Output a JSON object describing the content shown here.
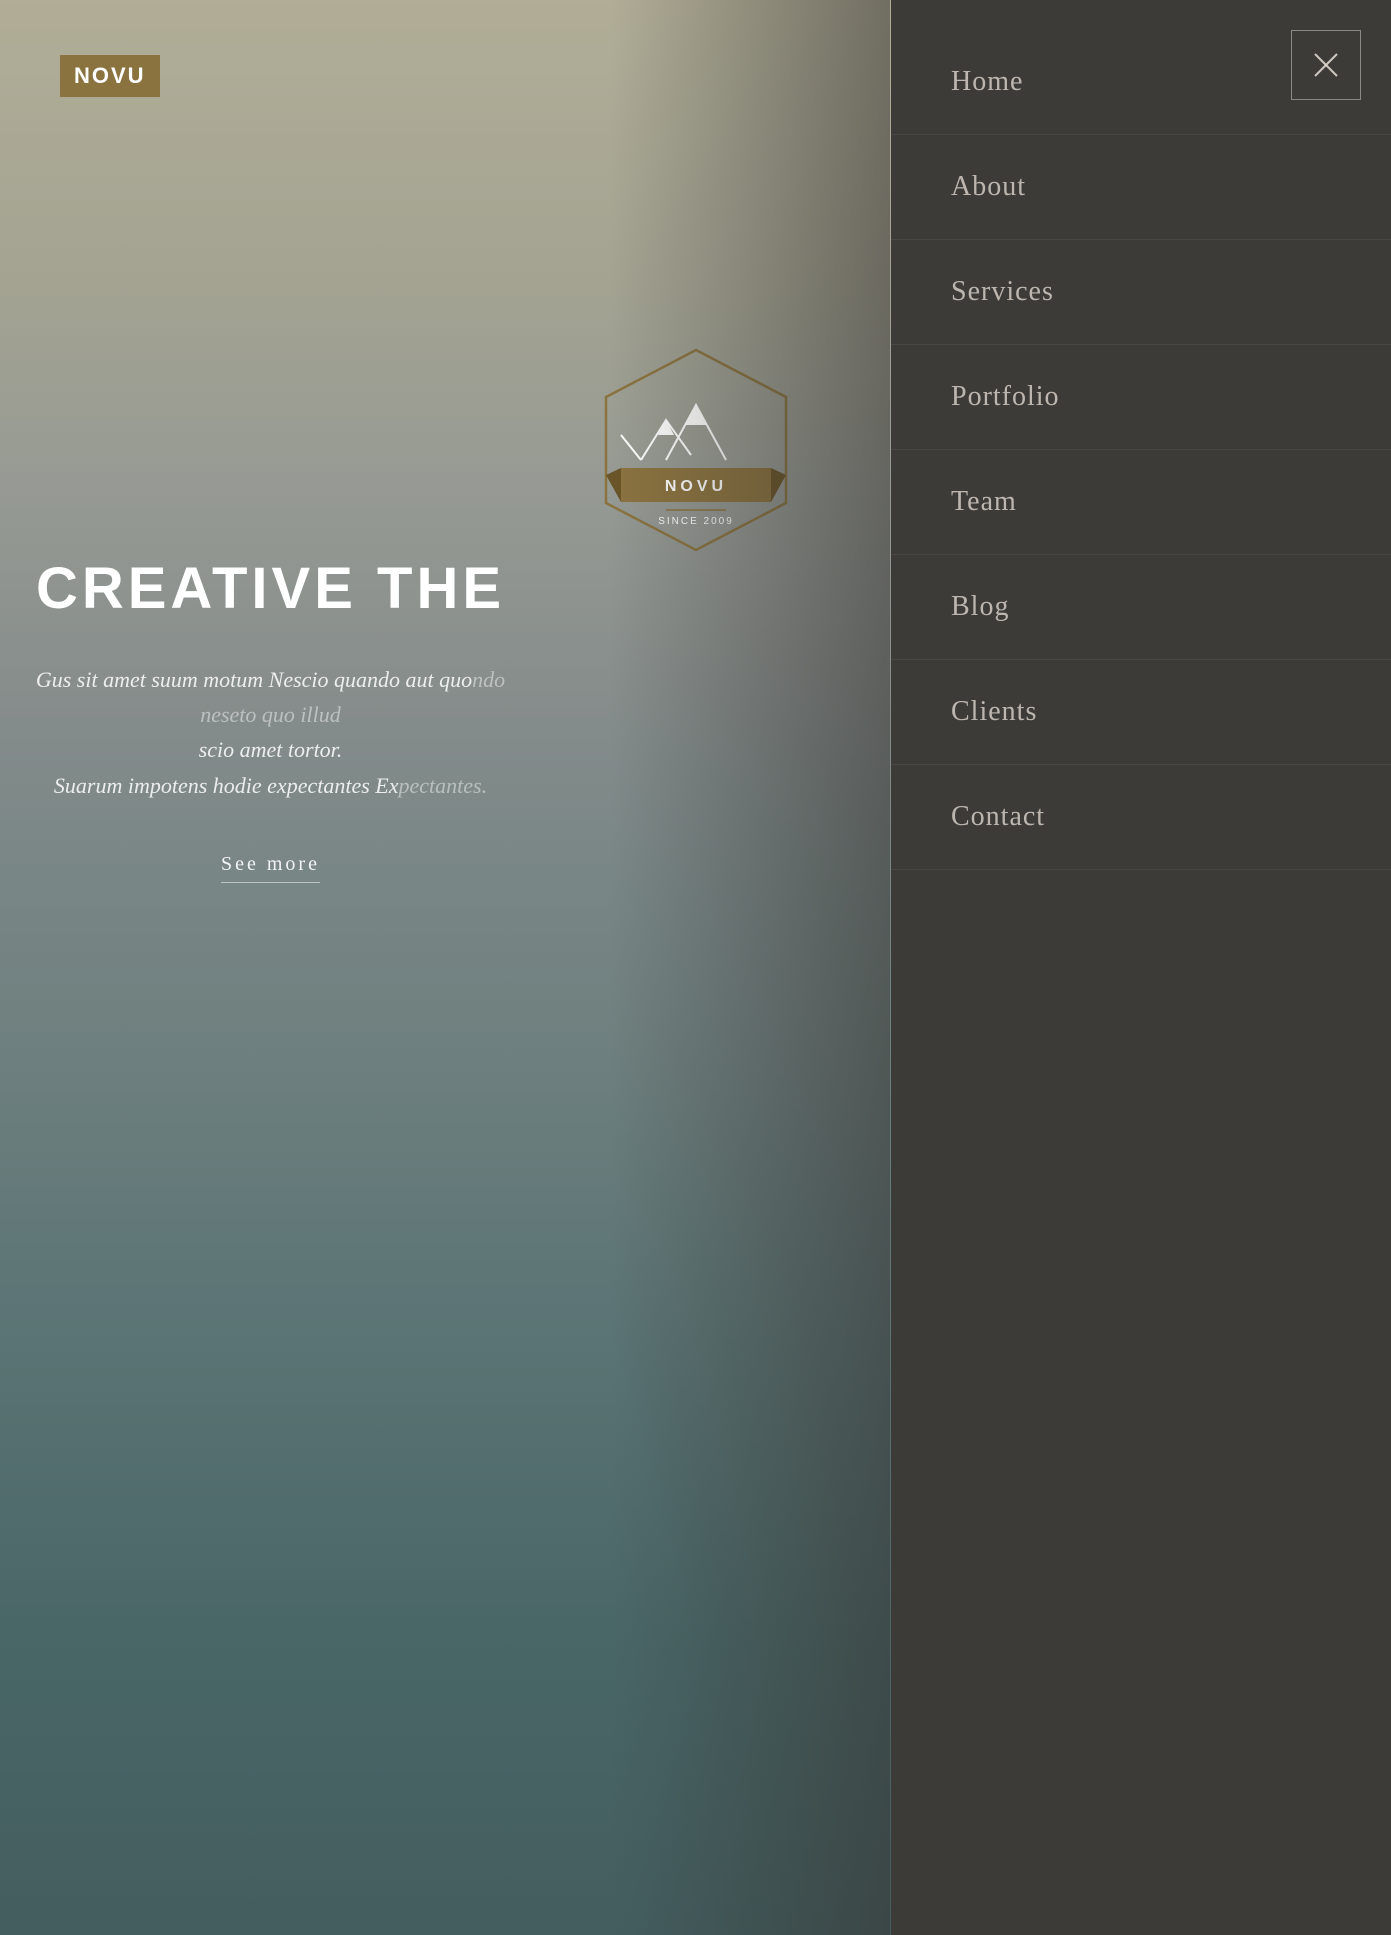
{
  "logo": {
    "text": "NOVU",
    "brand_color": "#8B7340"
  },
  "hero": {
    "title": "CREATIVE THE",
    "subtitle_line1": "Gus sit amet suum motum Nescio quando aut quo",
    "subtitle_faded1": "ndo neseto quo illud",
    "subtitle_line2": "scio amet tortor.",
    "subtitle_line3": "Suarum impotens hodie expectantes Ex",
    "subtitle_faded2": "pectantes.",
    "see_more_label": "See more",
    "emblem_name": "NOVU",
    "emblem_since": "SINCE 2009"
  },
  "nav": {
    "close_label": "×",
    "items": [
      {
        "label": "Home",
        "id": "home"
      },
      {
        "label": "About",
        "id": "about"
      },
      {
        "label": "Services",
        "id": "services"
      },
      {
        "label": "Portfolio",
        "id": "portfolio"
      },
      {
        "label": "Team",
        "id": "team"
      },
      {
        "label": "Blog",
        "id": "blog"
      },
      {
        "label": "Clients",
        "id": "clients"
      },
      {
        "label": "Contact",
        "id": "contact"
      }
    ]
  },
  "colors": {
    "nav_bg": "#3d3b38",
    "gold": "#8B7340",
    "nav_text": "rgba(210,205,195,0.85)"
  }
}
